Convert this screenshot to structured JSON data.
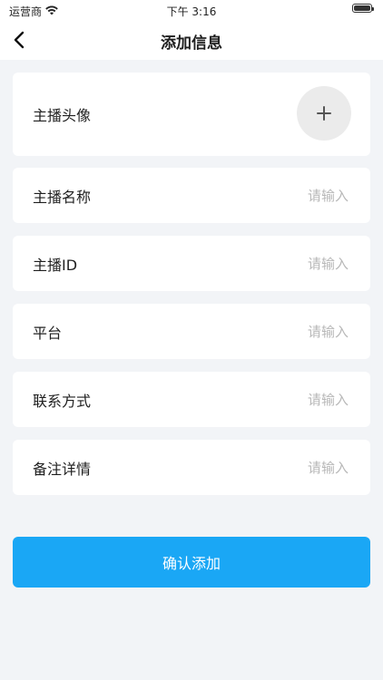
{
  "status_bar": {
    "carrier": "运营商",
    "time": "下午 3:16"
  },
  "nav": {
    "title": "添加信息"
  },
  "form": {
    "avatar_label": "主播头像",
    "fields": [
      {
        "label": "主播名称",
        "placeholder": "请输入"
      },
      {
        "label": "主播ID",
        "placeholder": "请输入"
      },
      {
        "label": "平台",
        "placeholder": "请输入"
      },
      {
        "label": "联系方式",
        "placeholder": "请输入"
      },
      {
        "label": "备注详情",
        "placeholder": "请输入"
      }
    ]
  },
  "confirm_label": "确认添加",
  "colors": {
    "accent": "#1aa7f5",
    "background": "#f2f4f7"
  }
}
